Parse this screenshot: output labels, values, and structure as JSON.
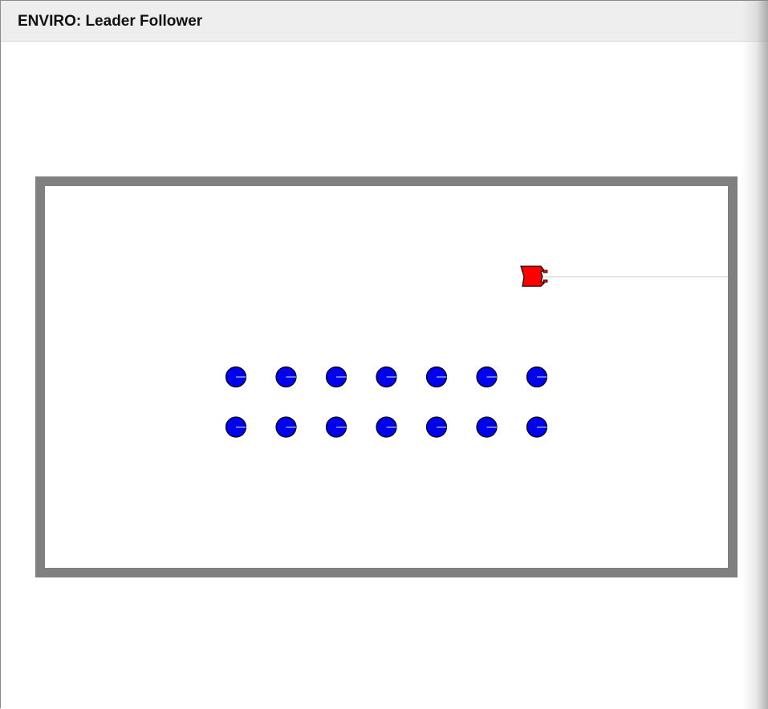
{
  "window": {
    "title": "ENVIRO: Leader Follower"
  },
  "scene": {
    "colors": {
      "wall": "#808080",
      "leader": "#ff0000",
      "follower": "#0000ee",
      "sensor_ray": "#e6e6e6",
      "outline": "#000000"
    },
    "leader": {
      "shape": "rectangle-robot",
      "heading": "right"
    },
    "followers": {
      "rows": 2,
      "columns": 7,
      "shape": "circle-robot",
      "heading": "right"
    }
  }
}
